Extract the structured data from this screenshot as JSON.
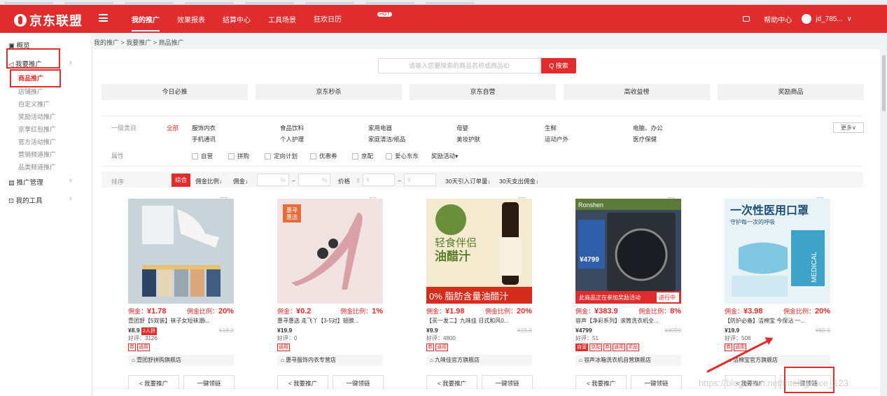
{
  "topbar": {
    "brand": "京东联盟",
    "nav": [
      "我的推广",
      "效果报表",
      "结算中心",
      "工具场景",
      "狂欢日历"
    ],
    "hot_badge": "HOT",
    "help": "帮助中心",
    "user": "jd_785..."
  },
  "sidebar": {
    "overview": "概览",
    "promote": "我要推广",
    "sub": [
      "商品推广",
      "店铺推广",
      "自定义推广",
      "奖励活动推广",
      "京享红包推广",
      "官方活动推广",
      "营销频道推广",
      "品类频道推广"
    ],
    "manage": "推广管理",
    "tools": "我的工具"
  },
  "breadcrumb": [
    "我的推广",
    "我要推广",
    "商品推广"
  ],
  "search": {
    "placeholder": "请输入您要搜索的商品名称或商品ID",
    "button": "Q 搜索"
  },
  "quick_tabs": [
    "今日必推",
    "京东秒杀",
    "京东自营",
    "高收益榜",
    "奖励商品"
  ],
  "filters": {
    "cat_label": "一级类目",
    "all": "全部",
    "cats": [
      "服饰内衣",
      "食品饮料",
      "家用电器",
      "母婴",
      "生鲜",
      "电脑、办公",
      "手机通讯",
      "个人护理",
      "家庭清洁/纸品",
      "美妆护肤",
      "运动户外",
      "医疗保健"
    ],
    "more": "更多∨",
    "attr_label": "属性",
    "attrs": [
      "自营",
      "拼购",
      "定向计划",
      "优惠券",
      "京配",
      "爱心东东",
      "奖励活动▾"
    ],
    "sort_label": "排序",
    "sorts": [
      "综合",
      "佣金比例↓",
      "佣金↓",
      "价格",
      "30天引入订单量↓",
      "30天支出佣金↓"
    ],
    "pct": "%",
    "yen": "¥",
    "dash": "–"
  },
  "products": [
    {
      "commission": "¥1.78",
      "rate": "20%",
      "title": "壹团舒【5双装】袜子女短袜潮i...",
      "price": "¥8.9",
      "badge": "2人拼",
      "orig": "¥18.9",
      "comments": "好评：3126",
      "tags": [
        "券",
        "通用"
      ],
      "shop": "壹团舒拼购旗舰店"
    },
    {
      "commission": "¥0.2",
      "rate": "1%",
      "title": "惠寻惠选 走飞丫【3-5对】翅膀...",
      "price": "¥19.9",
      "badge": "",
      "orig": "",
      "comments": "好评：0",
      "tags": [
        "通用"
      ],
      "shop": "惠寻服饰内衣专营店"
    },
    {
      "commission": "¥1.98",
      "rate": "20%",
      "title": "【买一发二】九味佳 日式和风0...",
      "price": "¥9.9",
      "badge": "",
      "orig": "¥19.9",
      "comments": "好评：4800",
      "tags": [
        "券",
        "通用"
      ],
      "shop": "九味佳官方旗舰店"
    },
    {
      "commission": "¥383.9",
      "rate": "8%",
      "title": "容声【净彩系列】滚筒洗衣机全...",
      "price": "¥4799",
      "badge": "",
      "orig": "¥4999",
      "comments": "好评：51",
      "tags": [
        "自营",
        "京配",
        "券",
        "通用",
        "奖励"
      ],
      "shop": "容声冰箱洗衣机自营旗舰店"
    },
    {
      "commission": "¥3.98",
      "rate": "20%",
      "title": "【防护必备】洁棉宝 今保沾 一...",
      "price": "¥19.9",
      "badge": "",
      "orig": "¥69.9",
      "comments": "好评：508",
      "tags": [
        "券",
        "通用"
      ],
      "shop": "洁棉宝官方旗舰店"
    }
  ],
  "labels": {
    "commission": "佣金：",
    "rate": "佣金比例：",
    "promote": "< 我要推广",
    "link": "一键领链"
  },
  "product_texts": {
    "p3_a": "轻食伴侣",
    "p3_b": "油醋汁",
    "p3_c": "0% 脂肪含量油醋汁",
    "p4_brand": "Ronshen",
    "p4_price": "¥4799",
    "p4_banner": "此商品正在参加奖励活动",
    "p4_status": "进行中",
    "p5_a": "一次性医用口罩",
    "p5_b": "守护每一次的呼吸",
    "p5_c": "MEDICAL",
    "p2_a": "惠寻",
    "p2_b": "惠选"
  },
  "watermark": "https://blog.csdn.net/intelligence_123"
}
